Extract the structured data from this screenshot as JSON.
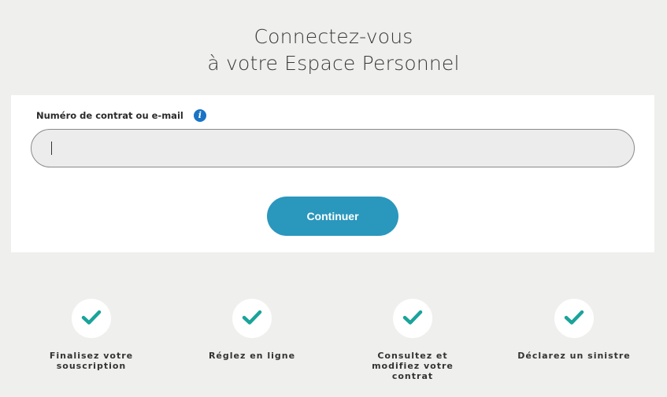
{
  "header": {
    "title_line1": "Connectez-vous",
    "title_line2": "à votre Espace Personnel"
  },
  "login_form": {
    "label": "Numéro de contrat ou e-mail",
    "info_icon": "info-icon",
    "input_value": "",
    "input_placeholder": "",
    "submit_label": "Continuer",
    "accent_color": "#2a97bd"
  },
  "features": {
    "icon": "check-icon",
    "check_color": "#1aa39a",
    "items": [
      {
        "label": "Finalisez votre\nsouscription"
      },
      {
        "label": "Réglez en ligne"
      },
      {
        "label": "Consultez et\nmodifiez votre\ncontrat"
      },
      {
        "label": "Déclarez un sinistre"
      }
    ]
  }
}
